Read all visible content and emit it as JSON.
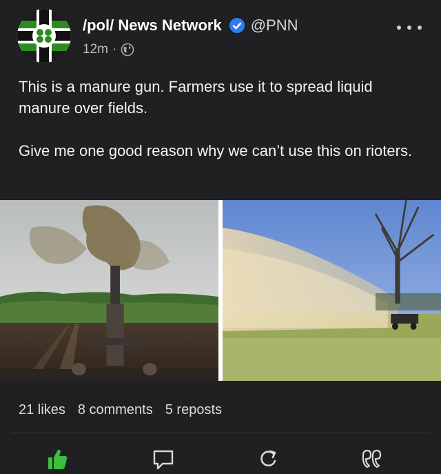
{
  "post": {
    "author_name": "/pol/ News Network",
    "handle": "@PNN",
    "time_ago": "12m",
    "separator": "·",
    "paragraphs": [
      "This is a manure gun. Farmers use it to spread liquid manure over fields.",
      "Give me one good reason why we can’t use this on rioters."
    ]
  },
  "stats": {
    "likes": "21 likes",
    "comments": "8 comments",
    "reposts": "5 reposts"
  },
  "icons": {
    "verified": "verified-badge-icon",
    "globe": "globe-icon",
    "more": "more-options-icon",
    "like": "thumbs-up-icon",
    "comment": "comment-icon",
    "repost": "repost-icon",
    "quote": "quote-icon"
  },
  "colors": {
    "background": "#202022",
    "verified": "#2f7cf6",
    "like": "#3bbf3f",
    "avatar_green": "#2e8b22"
  }
}
